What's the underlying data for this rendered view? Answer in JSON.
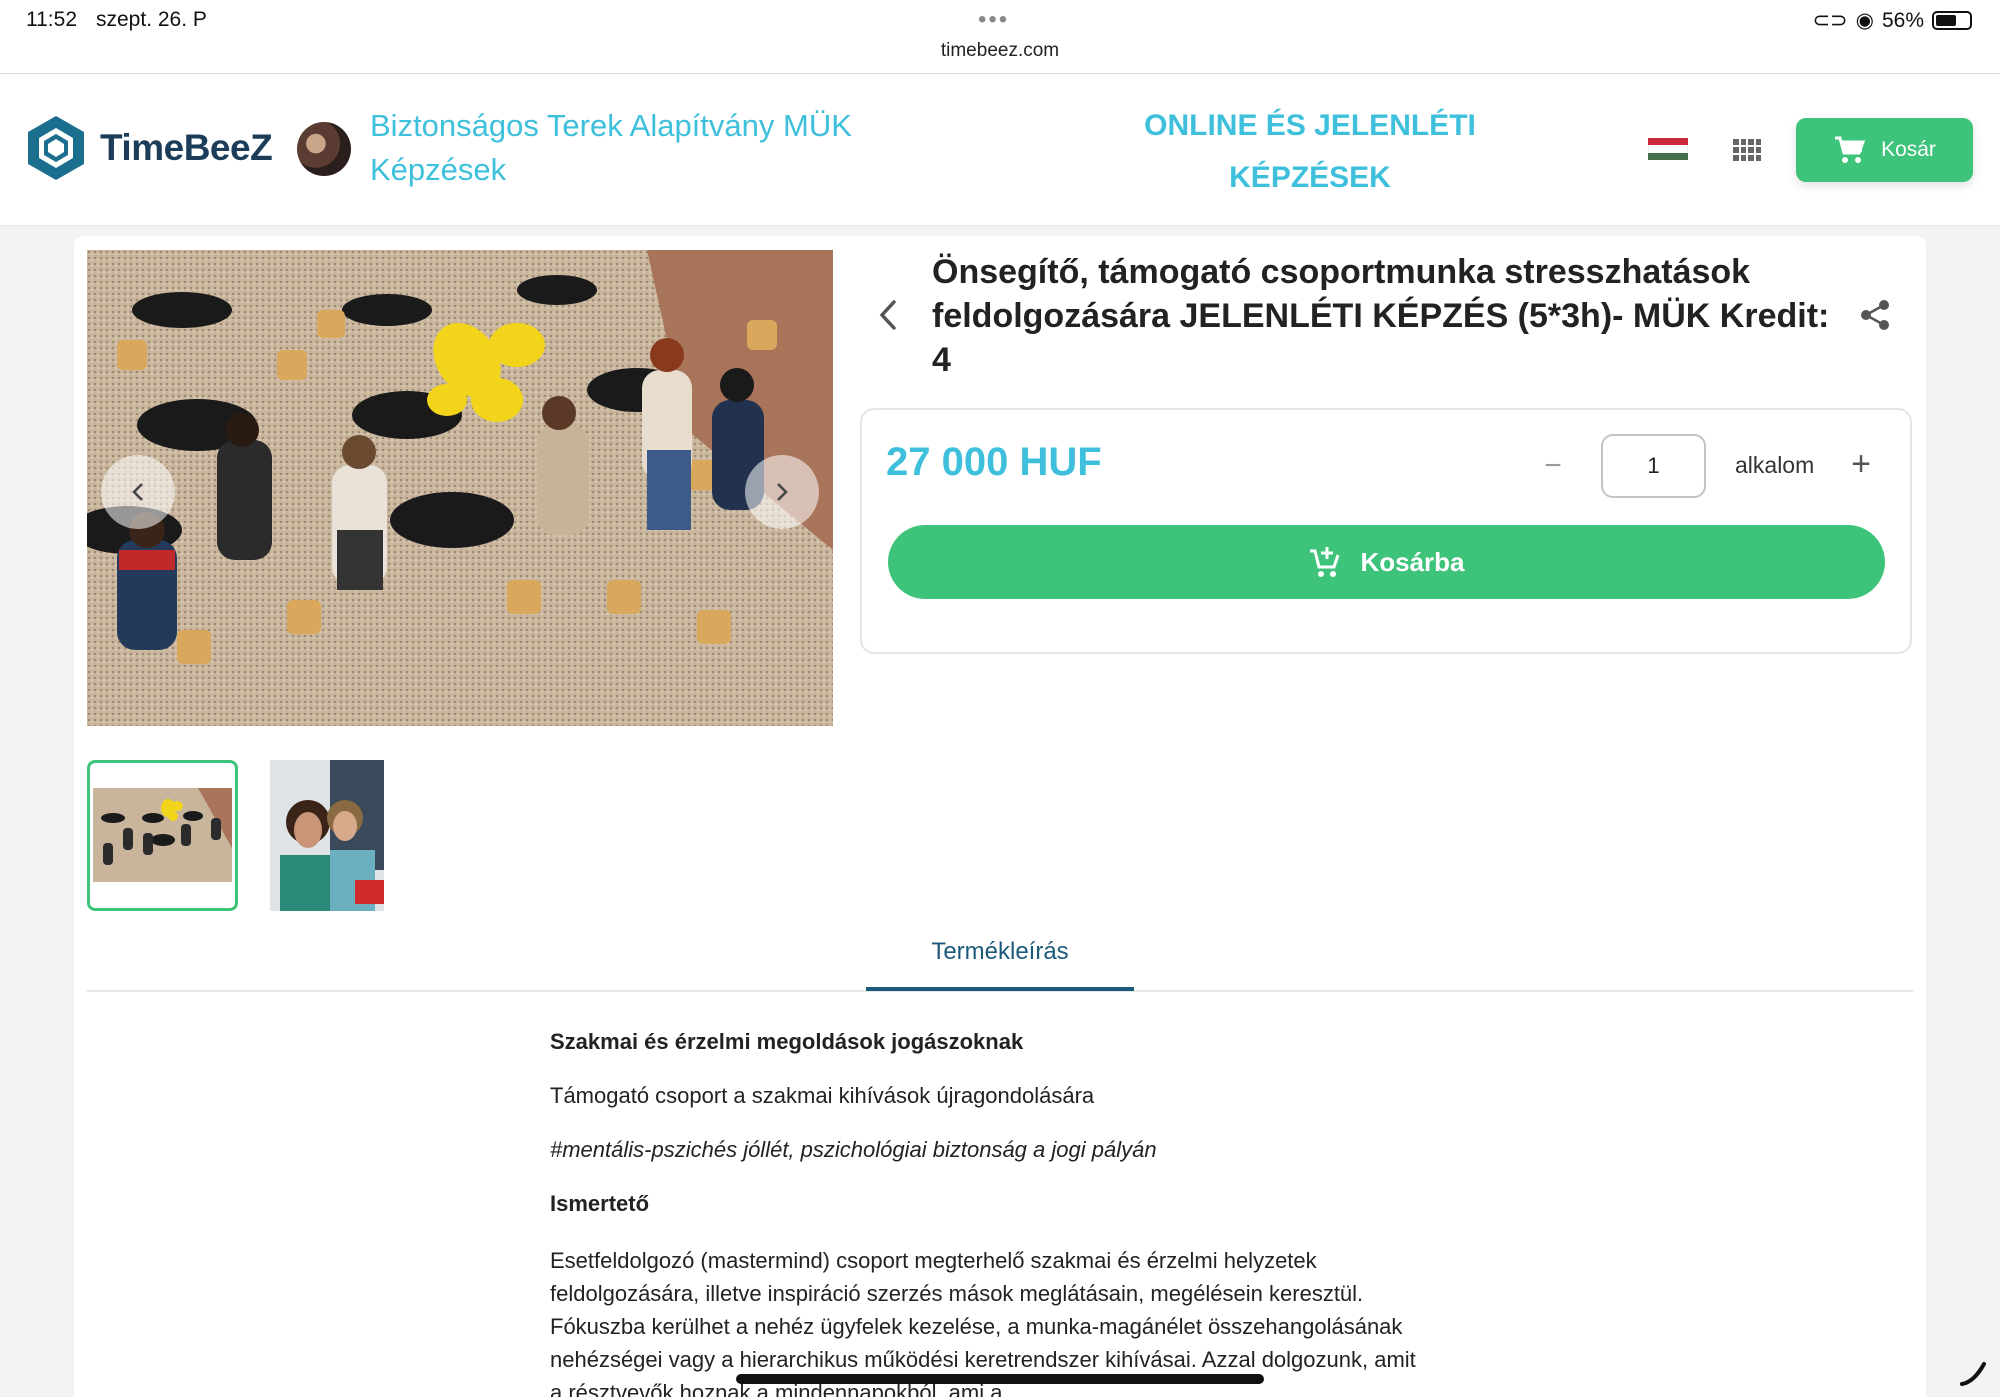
{
  "statusbar": {
    "time": "11:52",
    "date": "szept. 26. P",
    "url": "timebeez.com",
    "battery": "56%"
  },
  "header": {
    "brand": "TimeBeeZ",
    "org_title": "Biztonságos Terek Alapítvány MÜK Képzések",
    "nav_title": "ONLINE ÉS JELENLÉTI KÉPZÉSEK",
    "cart_label": "Kosár",
    "flag_colors": [
      "#cd2a3e",
      "#ffffff",
      "#436f4d"
    ]
  },
  "product": {
    "title": "Önsegítő, támogató csoportmunka stresszhatások feldolgozására JELENLÉTI KÉPZÉS (5*3h)- MÜK Kredit: 4",
    "price": "27 000 HUF",
    "quantity": "1",
    "unit": "alkalom",
    "add_to_cart": "Kosárba"
  },
  "tabs": [
    {
      "label": "Termékleírás",
      "active": true
    }
  ],
  "description": {
    "heading": "Szakmai és érzelmi megoldások jogászoknak",
    "subtitle": "Támogató csoport a szakmai kihívások újragondolására",
    "hashtag": "#mentális-pszichés jóllét, pszichológiai biztonság a jogi pályán",
    "section_title": "Ismertető",
    "paragraph": "Esetfeldolgozó (mastermind) csoport megterhelő szakmai és érzelmi helyzetek feldolgozására, illetve inspiráció szerzés mások meglátásain, megélésein keresztül. Fókuszba kerülhet a nehéz ügyfelek kezelése, a munka-magánélet összehangolásának nehézségei vagy a hierarchikus működési keretrendszer kihívásai. Azzal dolgozunk, amit a résztvevők hoznak a mindennapokból, ami a"
  },
  "colors": {
    "accent_green": "#3dc47a",
    "accent_cyan": "#3ec0dc",
    "brand_navy": "#1c3d5a",
    "tab_blue": "#1c5a7a"
  },
  "icons": [
    "logo-hexagon-icon",
    "hungarian-flag-icon",
    "apps-grid-icon",
    "cart-icon",
    "chevron-left-icon",
    "chevron-right-icon",
    "share-icon",
    "add-cart-icon",
    "minus-icon",
    "plus-icon"
  ]
}
